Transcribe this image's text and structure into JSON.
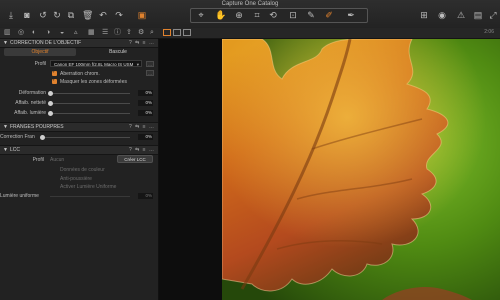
{
  "window": {
    "title": "Capture One Catalog"
  },
  "toolbar": {
    "left_icons": [
      "download-icon",
      "camera-icon",
      "rotate-left-icon",
      "rotate-right-icon",
      "trash-icon",
      "undo-icon",
      "redo-icon",
      "layers-icon"
    ],
    "cursor_tools": [
      "pointer-icon",
      "hand-icon",
      "zoom-icon",
      "crop-icon",
      "rotate-tool-icon",
      "keystone-icon",
      "brush-icon",
      "eyedropper-icon",
      "picker-icon"
    ],
    "right_icons": [
      "grid-icon",
      "eye-icon",
      "warning-icon",
      "view-icon",
      "expand-icon"
    ]
  },
  "strip": {
    "right_text": "2:06"
  },
  "panel": {
    "lens_section": {
      "title": "CORRECTION DE L'OBJECTIF",
      "controls": "? ⇆ ≡ …"
    },
    "tabs": [
      "Objectif",
      "Bascule"
    ],
    "profile_label": "Profil",
    "profile_value": "Canon EF 100mm f/2.8L Macro IS USM",
    "check1": "Aberration chrom.",
    "check2": "Masquer les zones déformées",
    "rows": [
      {
        "label": "Déformation",
        "value": "0%"
      },
      {
        "label": "Affaib. netteté",
        "value": "0%"
      },
      {
        "label": "Affaib. lumière",
        "value": "0%"
      }
    ],
    "fringe_section": {
      "title": "FRANGES POURPRES",
      "controls": "? ⇆ ≡ …"
    },
    "fringe_label": "Correction Fran",
    "fringe_value": "0%",
    "lcc_section": {
      "title": "LCC",
      "controls": "? ⇆ ≡ …"
    },
    "lcc_profile_label": "Profil",
    "lcc_profile_value": "Aucun",
    "lcc_button": "Créer LCC",
    "lcc_options": [
      "Données de couleur",
      "Anti-poussière",
      "Activer Lumière Uniforme"
    ],
    "uniform_label": "Lumière uniforme",
    "uniform_value": "0%"
  },
  "colors": {
    "accent": "#e0822e",
    "panel": "#222222",
    "background": "#1b1b1b"
  }
}
